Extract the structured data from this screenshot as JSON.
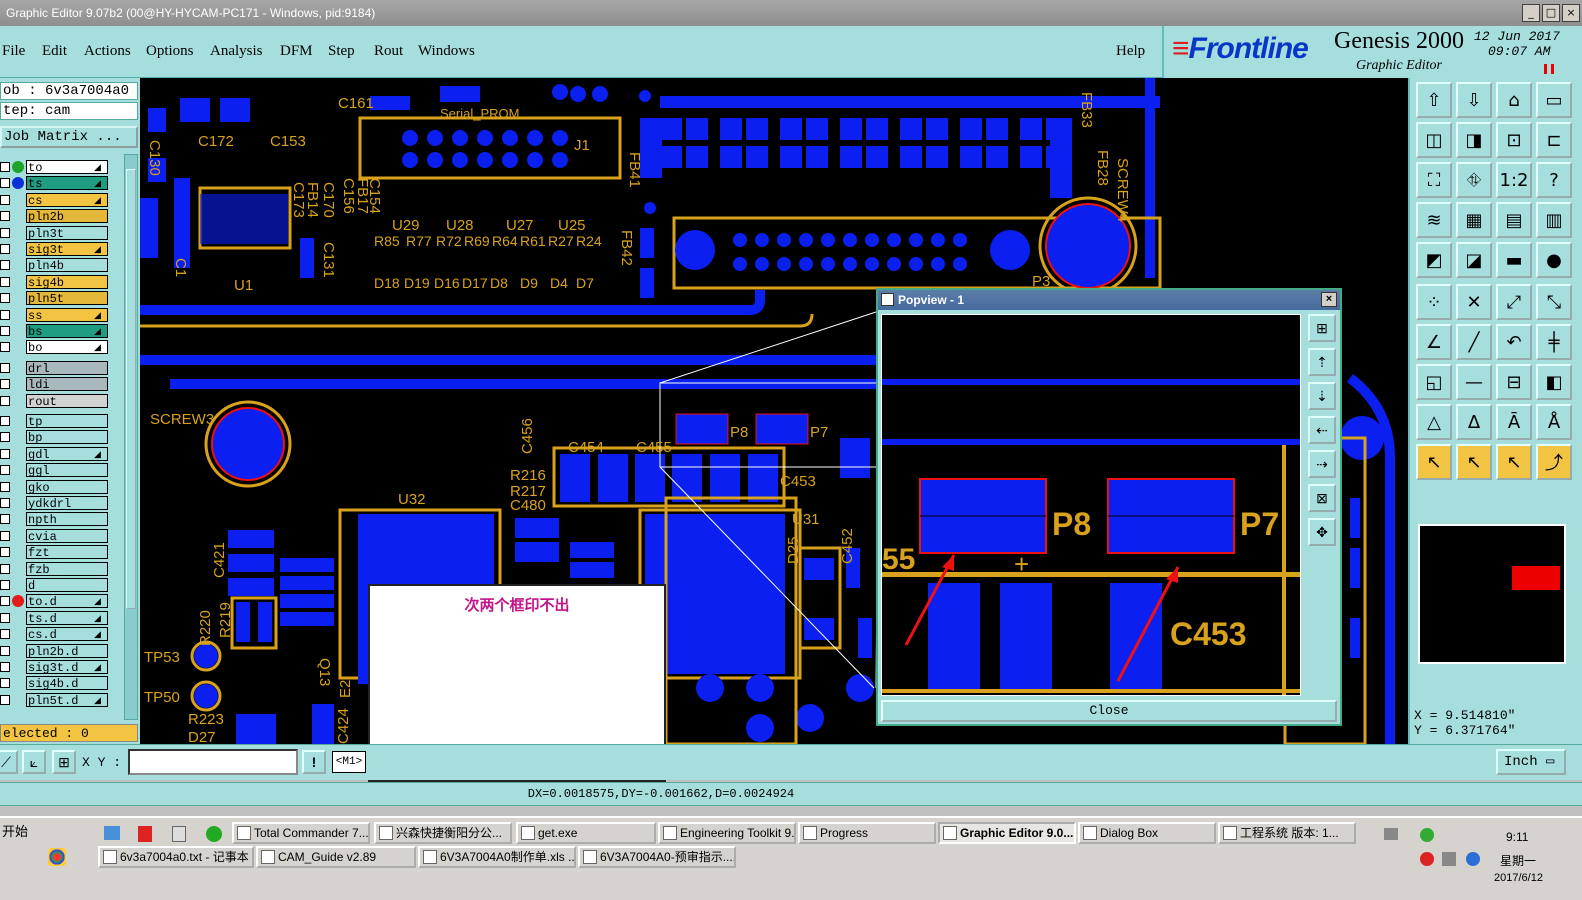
{
  "window": {
    "title": "Graphic Editor 9.07b2 (00@HY-HYCAM-PC171 - Windows, pid:9184)",
    "btn_min": "_",
    "btn_max": "□",
    "btn_close": "×"
  },
  "menu": {
    "items": [
      "File",
      "Edit",
      "Actions",
      "Options",
      "Analysis",
      "DFM",
      "Step",
      "Rout",
      "Windows"
    ],
    "help": "Help"
  },
  "brand": {
    "logo": "Frontline",
    "product": "Genesis 2000",
    "subtitle": "Graphic Editor",
    "date": "12 Jun 2017",
    "time": "09:07 AM"
  },
  "left_panel": {
    "job": "ob : 6v3a7004a0",
    "step": "tep: cam",
    "matrix_button": "Job Matrix ...",
    "selected": "elected : 0",
    "layers": [
      {
        "name": "to",
        "bg": "#ffffff",
        "dot": "#1fa32a",
        "arrow": true
      },
      {
        "name": "ts",
        "bg": "#1f9c82",
        "dot": "#0a2fd6",
        "arrow": true
      },
      {
        "name": "cs",
        "bg": "#f3c441",
        "dot": "",
        "arrow": true
      },
      {
        "name": "pln2b",
        "bg": "#e6b83a",
        "dot": "",
        "arrow": false
      },
      {
        "name": "pln3t",
        "bg": "#a6dede",
        "dot": "",
        "arrow": false
      },
      {
        "name": "sig3t",
        "bg": "#f3c441",
        "dot": "",
        "arrow": true
      },
      {
        "name": "pln4b",
        "bg": "#a6dede",
        "dot": "",
        "arrow": false
      },
      {
        "name": "sig4b",
        "bg": "#f3c441",
        "dot": "",
        "arrow": false
      },
      {
        "name": "pln5t",
        "bg": "#e6b83a",
        "dot": "",
        "arrow": false
      },
      {
        "name": "ss",
        "bg": "#f3c441",
        "dot": "",
        "arrow": true
      },
      {
        "name": "bs",
        "bg": "#1f9c82",
        "dot": "",
        "arrow": true
      },
      {
        "name": "bo",
        "bg": "#ffffff",
        "dot": "",
        "arrow": true
      },
      {
        "name": "drl",
        "bg": "#a9b8bd",
        "dot": "",
        "arrow": false
      },
      {
        "name": "ldi",
        "bg": "#a9b8bd",
        "dot": "",
        "arrow": false
      },
      {
        "name": "rout",
        "bg": "#d3d3d3",
        "dot": "",
        "arrow": false
      },
      {
        "name": "tp",
        "bg": "#a6dede",
        "dot": "",
        "arrow": false
      },
      {
        "name": "bp",
        "bg": "#a6dede",
        "dot": "",
        "arrow": false
      },
      {
        "name": "gdl",
        "bg": "#a6dede",
        "dot": "",
        "arrow": true
      },
      {
        "name": "ggl",
        "bg": "#a6dede",
        "dot": "",
        "arrow": false
      },
      {
        "name": "gko",
        "bg": "#a6dede",
        "dot": "",
        "arrow": false
      },
      {
        "name": "ydkdrl",
        "bg": "#a6dede",
        "dot": "",
        "arrow": false
      },
      {
        "name": "npth",
        "bg": "#a6dede",
        "dot": "",
        "arrow": false
      },
      {
        "name": "cvia",
        "bg": "#a6dede",
        "dot": "",
        "arrow": false
      },
      {
        "name": "fzt",
        "bg": "#a6dede",
        "dot": "",
        "arrow": false
      },
      {
        "name": "fzb",
        "bg": "#a6dede",
        "dot": "",
        "arrow": false
      },
      {
        "name": "d",
        "bg": "#a6dede",
        "dot": "",
        "arrow": false
      },
      {
        "name": "to.d",
        "bg": "#a6dede",
        "dot": "#e21b1b",
        "arrow": true
      },
      {
        "name": "ts.d",
        "bg": "#a6dede",
        "dot": "",
        "arrow": true
      },
      {
        "name": "cs.d",
        "bg": "#a6dede",
        "dot": "",
        "arrow": true
      },
      {
        "name": "pln2b.d",
        "bg": "#a6dede",
        "dot": "",
        "arrow": false
      },
      {
        "name": "sig3t.d",
        "bg": "#a6dede",
        "dot": "",
        "arrow": true
      },
      {
        "name": "sig4b.d",
        "bg": "#a6dede",
        "dot": "",
        "arrow": false
      },
      {
        "name": "pln5t.d",
        "bg": "#a6dede",
        "dot": "",
        "arrow": true
      }
    ]
  },
  "canvas": {
    "labels": [
      "C161",
      "C172",
      "C153",
      "Serial_PROM",
      "J1",
      "FB41",
      "FB33",
      "FB28",
      "SCREW4",
      "C130",
      "FB14",
      "C170",
      "C173",
      "FB17",
      "C156",
      "C154",
      "U29",
      "U28",
      "U27",
      "U25",
      "R85",
      "R77",
      "R72",
      "R69",
      "R64",
      "R61",
      "R27",
      "R24",
      "D18",
      "D19",
      "D16",
      "D17",
      "D8",
      "D9",
      "D4",
      "D7",
      "U1",
      "C131",
      "FB42",
      "P3",
      "SCREW3",
      "C456",
      "C454",
      "C455",
      "P8",
      "P7",
      "R216",
      "R217",
      "C480",
      "C453",
      "U32",
      "U31",
      "D25",
      "C452",
      "C421",
      "R220",
      "R219",
      "TP53",
      "Q13",
      "TP50",
      "R223",
      "D27",
      "E2",
      "C424"
    ]
  },
  "popup": {
    "title": "Popview - 1",
    "close_x": "×",
    "close": "Close",
    "labels": [
      "P8",
      "P7",
      "C453",
      "55"
    ]
  },
  "note": {
    "text": "次两个框印不出"
  },
  "right_panel": {
    "coord_x": "X =  9.514810\"",
    "coord_y": "Y =  6.371764\""
  },
  "command": {
    "xy_label": "X Y :",
    "xy_value": "",
    "bang": "!",
    "mode": "<M1>",
    "units": "Inch"
  },
  "status": {
    "text": "DX=0.0018575,DY=-0.001662,D=0.0024924"
  },
  "taskbar": {
    "start": "开始",
    "row1": [
      "Total Commander 7....",
      "兴森快捷衡阳分公...",
      "get.exe",
      "Engineering Toolkit 9...",
      "Progress",
      "Graphic Editor 9.0...",
      "Dialog Box",
      "工程系统  版本: 1..."
    ],
    "row2": [
      "6v3a7004a0.txt - 记事本",
      "CAM_Guide v2.89",
      "6V3A7004A0制作单.xls ...",
      "6V3A7004A0-预审指示...."
    ],
    "active_index": 5,
    "clock_time": "9:11",
    "clock_day": "星期一",
    "clock_date": "2017/6/12"
  },
  "colors": {
    "pcb_copper": "#0a1ff0",
    "silkscreen": "#d8a21c",
    "panel_bg": "#a6dede",
    "highlight": "#f3c441",
    "note_text": "#c4138a"
  }
}
